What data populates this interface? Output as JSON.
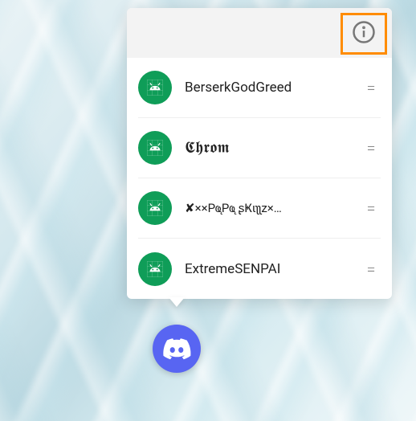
{
  "users": [
    {
      "name": "BerserkGodGreed"
    },
    {
      "name": "𝕮𝖍𝖗𝖔𝖒"
    },
    {
      "name": "✘××Pҩ̨Pҩ̨ ʂҜιʅʅz×…"
    },
    {
      "name": "ExtremeSENPAI"
    }
  ],
  "app": {
    "name": "Discord"
  },
  "highlight_color": "#ff8c00"
}
